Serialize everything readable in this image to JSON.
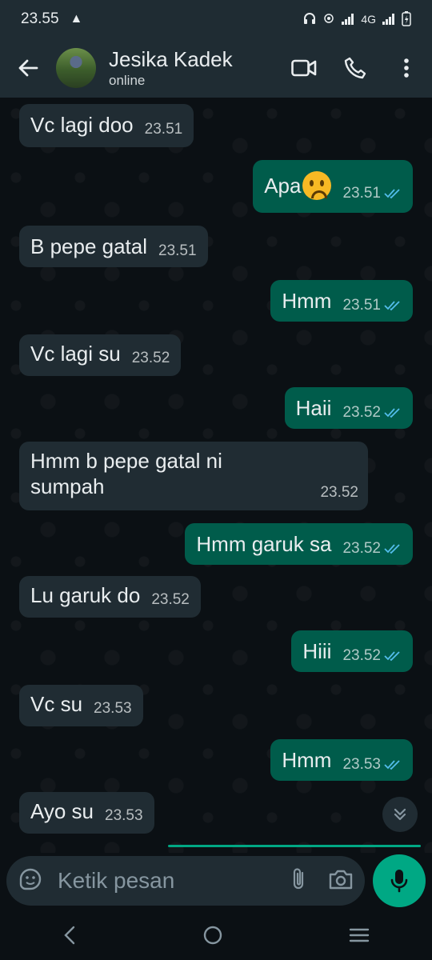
{
  "status_bar": {
    "time": "23.55",
    "network": "4G"
  },
  "header": {
    "contact_name": "Jesika Kadek",
    "status": "online"
  },
  "messages": [
    {
      "dir": "in",
      "text": "Vc lagi doo",
      "time": "23.51"
    },
    {
      "dir": "out",
      "text": "Apa",
      "emoji": "worried-face",
      "time": "23.51",
      "read": true
    },
    {
      "dir": "in",
      "text": "B pepe gatal",
      "time": "23.51"
    },
    {
      "dir": "out",
      "text": "Hmm",
      "time": "23.51",
      "read": true
    },
    {
      "dir": "in",
      "text": "Vc lagi su",
      "time": "23.52"
    },
    {
      "dir": "out",
      "text": "Haii",
      "time": "23.52",
      "read": true
    },
    {
      "dir": "in",
      "text": "Hmm b pepe gatal ni\nsumpah",
      "time": "23.52"
    },
    {
      "dir": "out",
      "text": "Hmm garuk sa",
      "time": "23.52",
      "read": true
    },
    {
      "dir": "in",
      "text": "Lu garuk do",
      "time": "23.52"
    },
    {
      "dir": "out",
      "text": "Hiii",
      "time": "23.52",
      "read": true
    },
    {
      "dir": "in",
      "text": "Vc su",
      "time": "23.53"
    },
    {
      "dir": "out",
      "text": "Hmm",
      "time": "23.53",
      "read": true
    },
    {
      "dir": "in",
      "text": "Ayo su",
      "time": "23.53"
    }
  ],
  "composer": {
    "placeholder": "Ketik pesan"
  },
  "colors": {
    "incoming": "#202c33",
    "outgoing": "#005c4b",
    "accent": "#00a884",
    "read_tick": "#53bdeb"
  },
  "icons": [
    "back-arrow-icon",
    "video-call-icon",
    "phone-icon",
    "more-vert-icon",
    "sticker-icon",
    "attach-icon",
    "camera-icon",
    "mic-icon",
    "scroll-down-icon",
    "nav-back-icon",
    "nav-home-icon",
    "nav-menu-icon"
  ]
}
